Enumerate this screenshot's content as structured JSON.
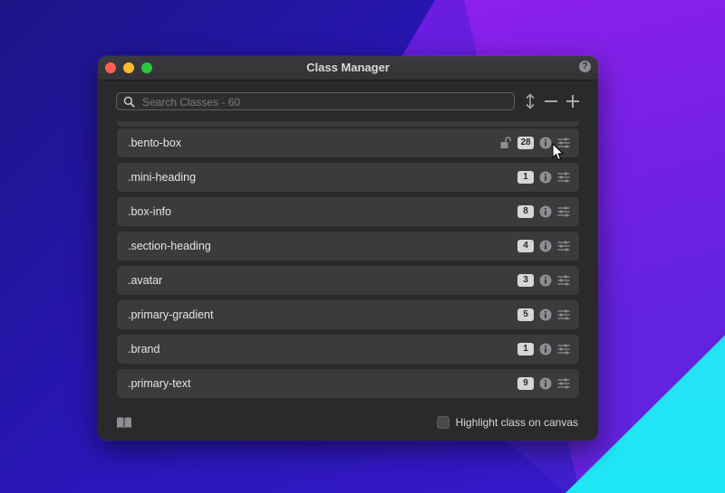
{
  "window": {
    "title": "Class Manager",
    "help_label": "?"
  },
  "search": {
    "placeholder": "Search Classes - 60",
    "value": ""
  },
  "toolbar": {
    "sort_icon": "sort-arrows-icon",
    "remove_icon": "minus-icon",
    "add_icon": "plus-icon"
  },
  "classes": [
    {
      "name": ".bento-box",
      "count": "28",
      "locked": true
    },
    {
      "name": ".mini-heading",
      "count": "1",
      "locked": false
    },
    {
      "name": ".box-info",
      "count": "8",
      "locked": false
    },
    {
      "name": ".section-heading",
      "count": "4",
      "locked": false
    },
    {
      "name": ".avatar",
      "count": "3",
      "locked": false
    },
    {
      "name": ".primary-gradient",
      "count": "5",
      "locked": false
    },
    {
      "name": ".brand",
      "count": "1",
      "locked": false
    },
    {
      "name": ".primary-text",
      "count": "9",
      "locked": false
    }
  ],
  "footer": {
    "highlight_label": "Highlight class on canvas",
    "highlight_on": false
  },
  "colors": {
    "row_bg": "#3b3b3d",
    "window_bg": "#2a2a2c",
    "badge_bg": "#d6d6d8"
  }
}
